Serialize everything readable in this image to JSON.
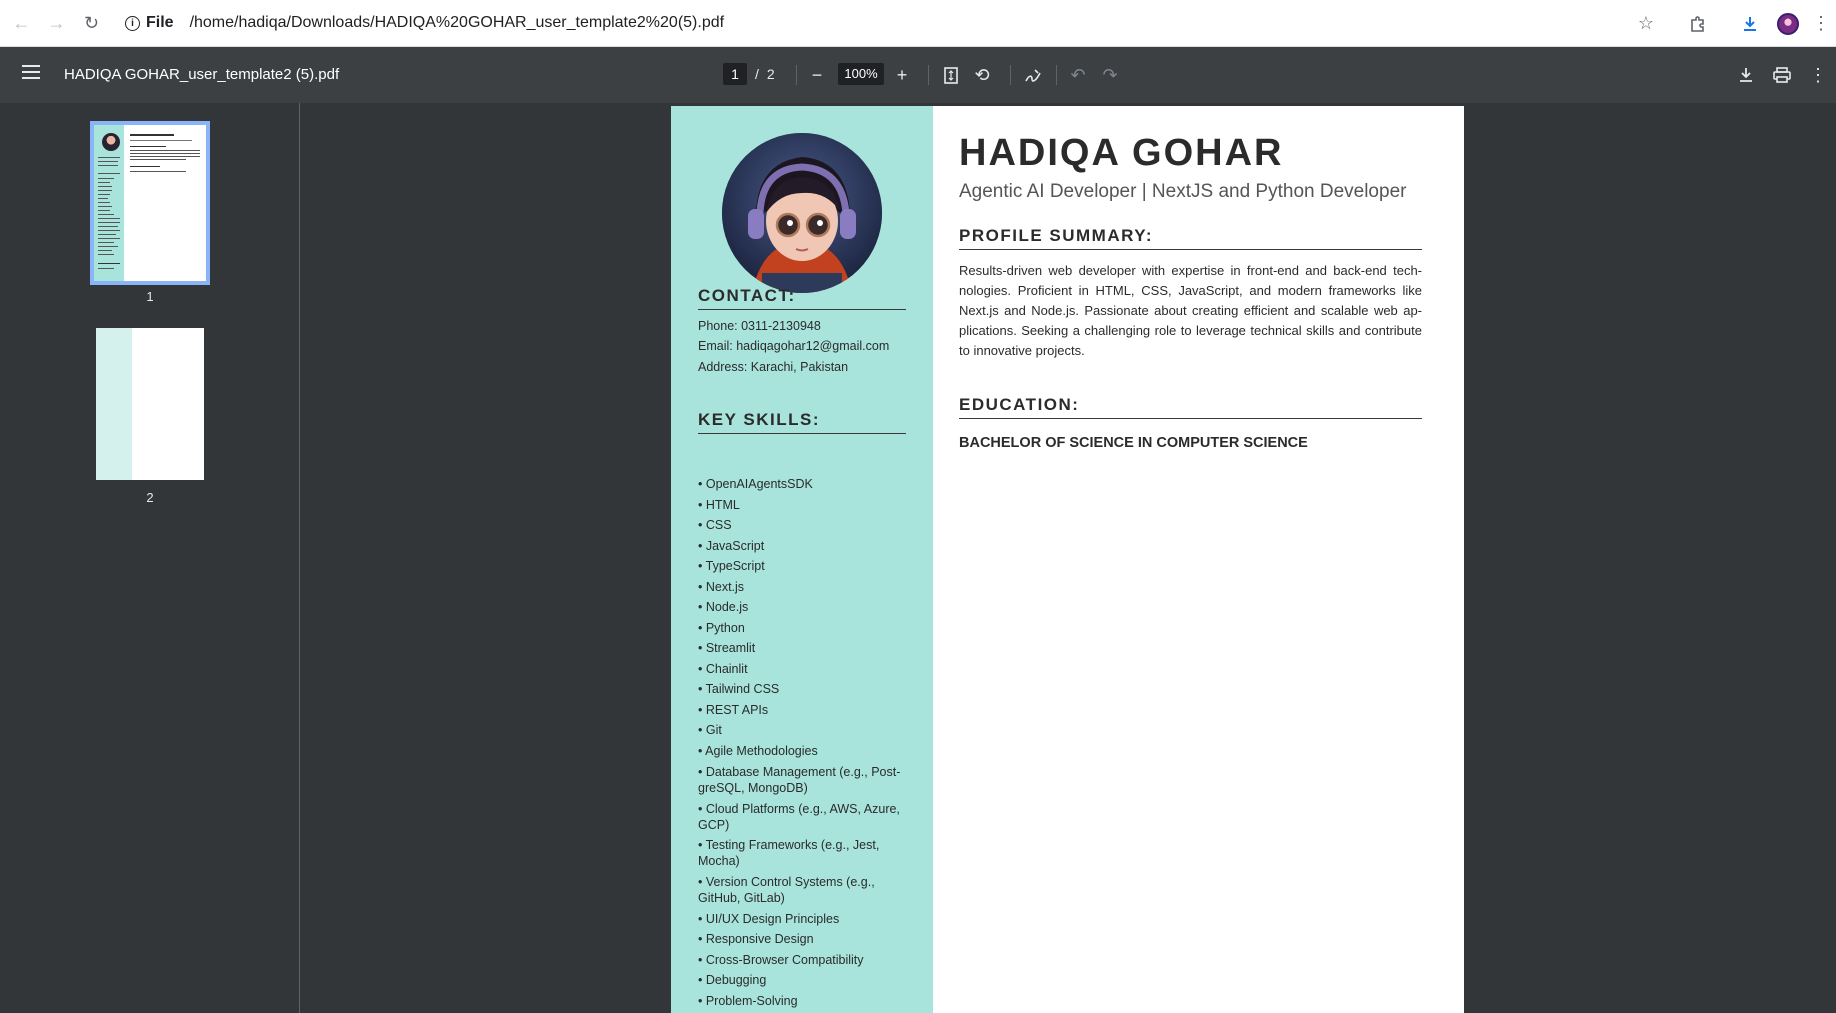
{
  "browser": {
    "site_label": "File",
    "url": "/home/hadiqa/Downloads/HADIQA%20GOHAR_user_template2%20(5).pdf"
  },
  "toolbar": {
    "doc_title": "HADIQA GOHAR_user_template2 (5).pdf",
    "current_page": "1",
    "page_sep": "/",
    "total_pages": "2",
    "zoom": "100%"
  },
  "sidebar": {
    "thumbnails": [
      {
        "label": "1"
      },
      {
        "label": "2"
      }
    ]
  },
  "resume": {
    "name": "HADIQA GOHAR",
    "role": "Agentic AI Developer | NextJS and Python Developer",
    "contact_heading": "CONTACT:",
    "phone": "Phone: 0311-2130948",
    "email": "Email: hadiqagohar12@gmail.com",
    "address": "Address: Karachi, Pakistan",
    "skills_heading": "KEY SKILLS:",
    "skills": [
      "• OpenAIAgentsSDK",
      "• HTML",
      "• CSS",
      "• JavaScript",
      "• TypeScript",
      "• Next.js",
      "• Node.js",
      "• Python",
      "• Streamlit",
      "• Chainlit",
      "• Tailwind CSS",
      "• REST APIs",
      "• Git",
      "• Agile Methodologies",
      "• Database Management (e.g., Post-greSQL, MongoDB)",
      "• Cloud Platforms (e.g., AWS, Azure, GCP)",
      "• Testing Frameworks (e.g., Jest, Mocha)",
      "• Version Control Systems (e.g., GitHub, GitLab)",
      "• UI/UX Design Principles",
      "• Responsive Design",
      "• Cross-Browser Compatibility",
      "• Debugging",
      "• Problem-Solving"
    ],
    "summary_heading": "PROFILE SUMMARY:",
    "summary": "Results-driven web developer with expertise in front-end and back-end tech-nologies. Proficient in HTML, CSS, JavaScript, and modern frameworks like Next.js and Node.js. Passionate about creating efficient and scalable web ap-plications. Seeking a challenging role to leverage technical skills and contribute to innovative projects.",
    "education_heading": "EDUCATION:",
    "degree": "BACHELOR OF SCIENCE IN COMPUTER SCIENCE"
  }
}
